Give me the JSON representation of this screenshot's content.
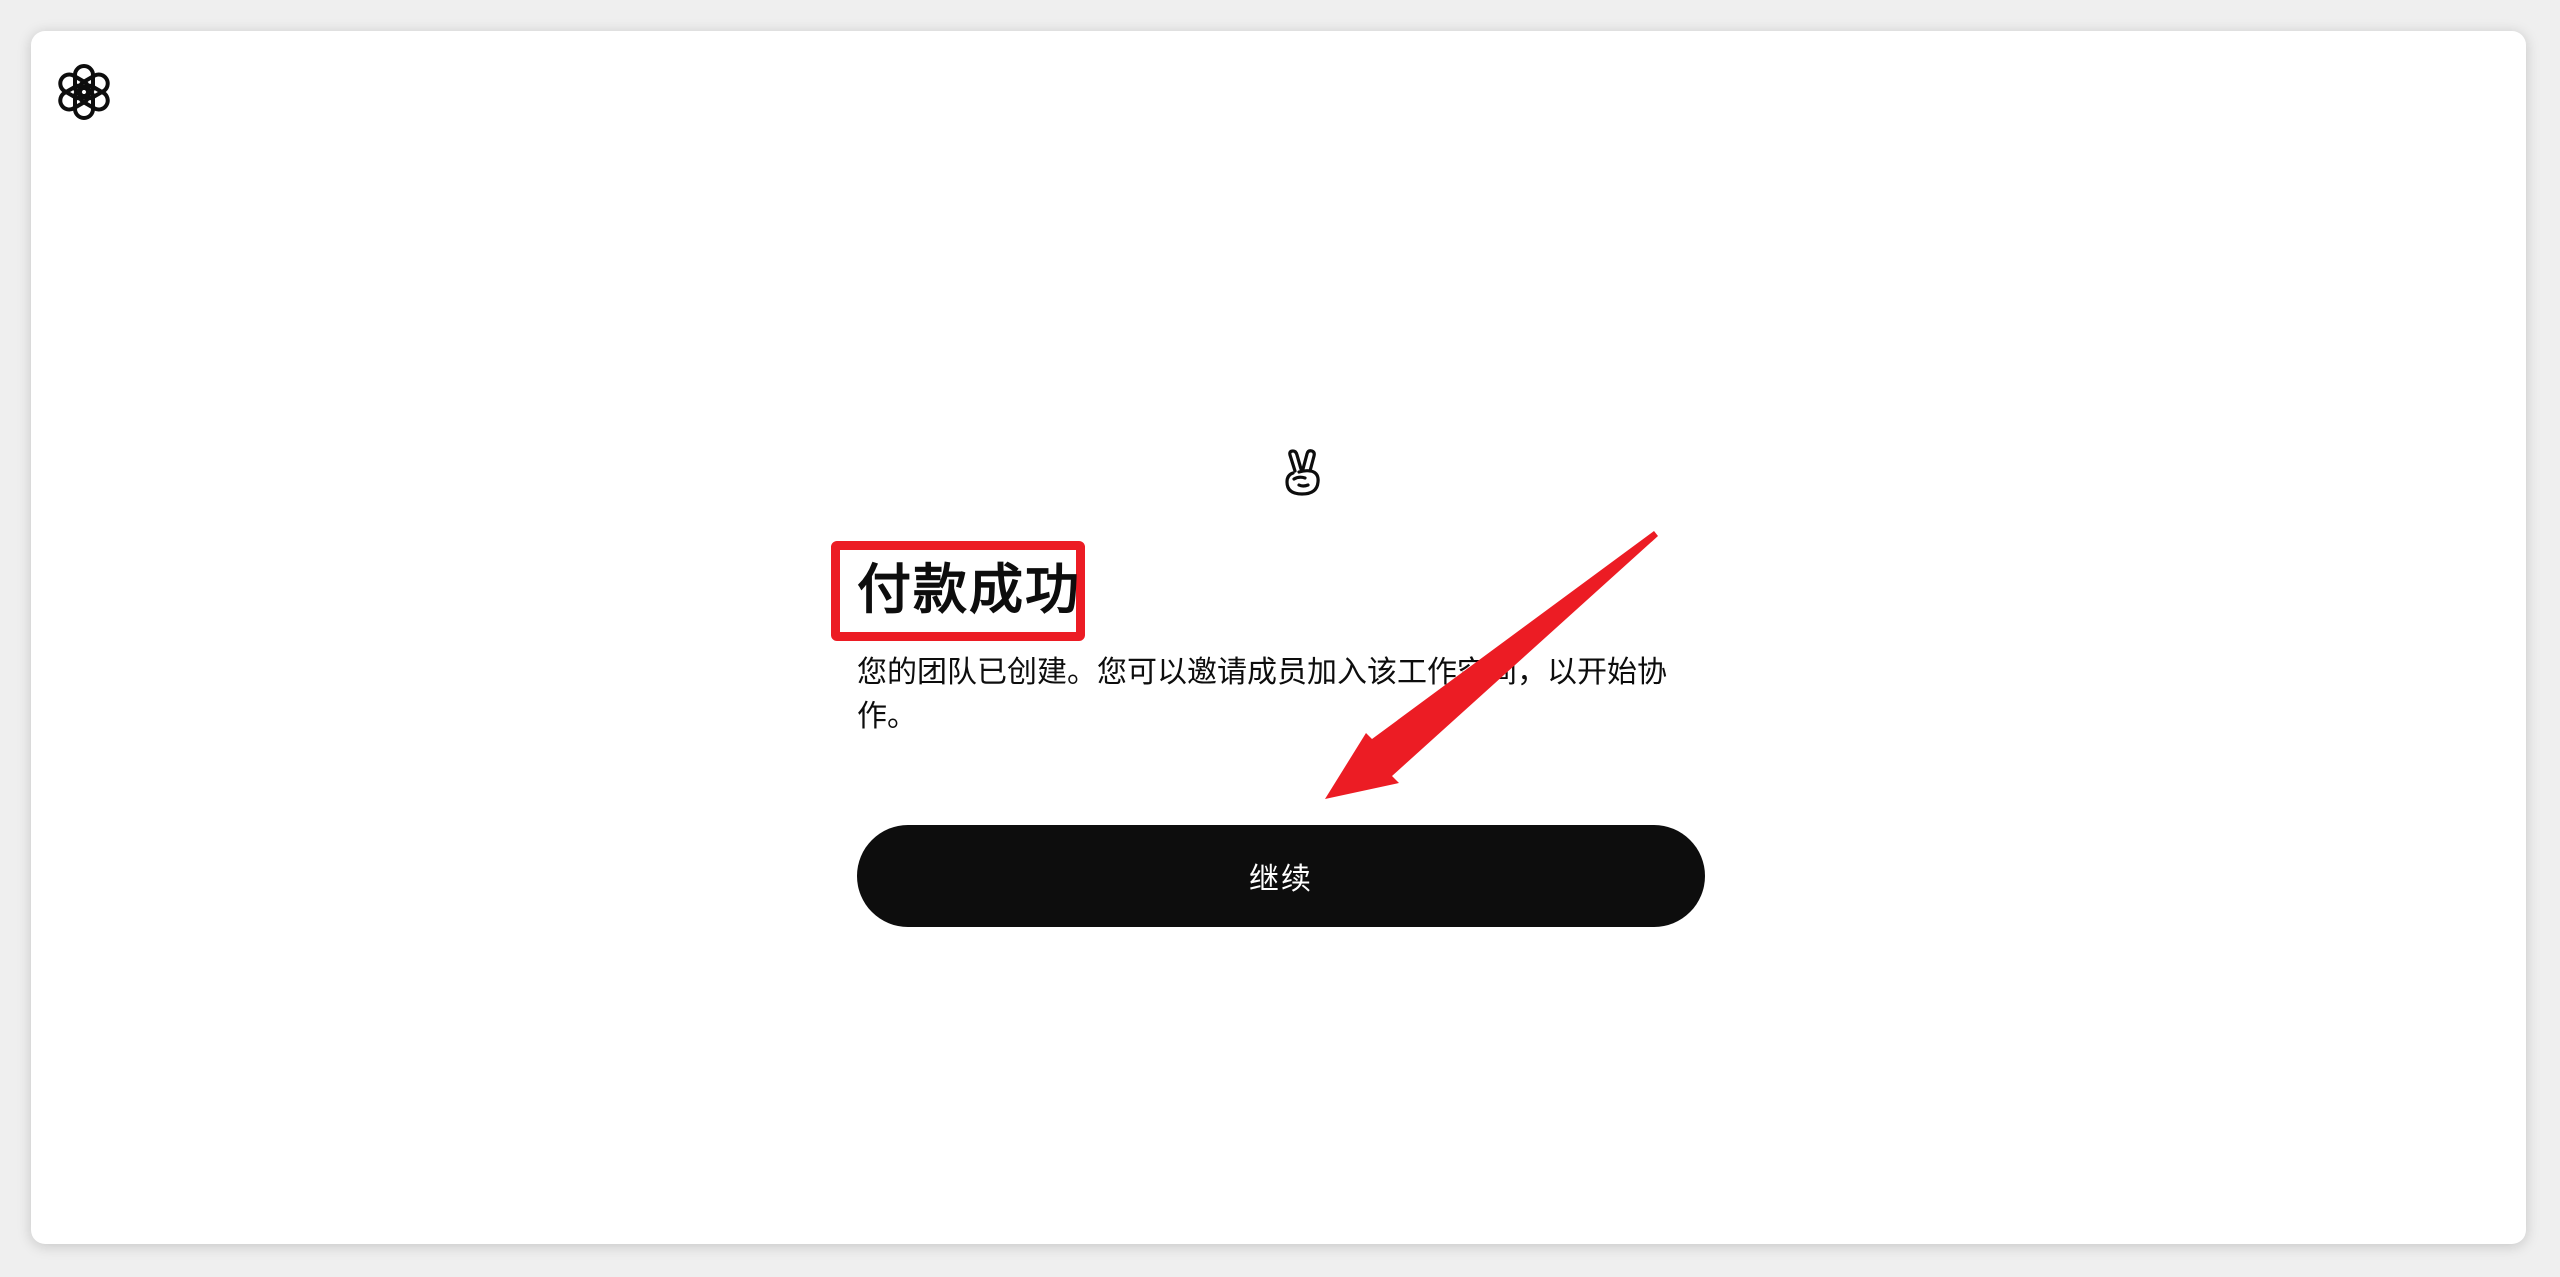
{
  "page": {
    "title": "付款成功",
    "description": "您的团队已创建。您可以邀请成员加入该工作空间，以开始协作。",
    "continue_label": "继续"
  },
  "icons": {
    "logo": "openai-logo-icon",
    "emoji": "victory-hand-icon",
    "annotation": "red-arrow-icon"
  },
  "colors": {
    "button_bg": "#0d0d0d",
    "button_text": "#ffffff",
    "highlight": "#ec1c24",
    "text": "#0d0d0d",
    "page_bg": "#ffffff"
  }
}
